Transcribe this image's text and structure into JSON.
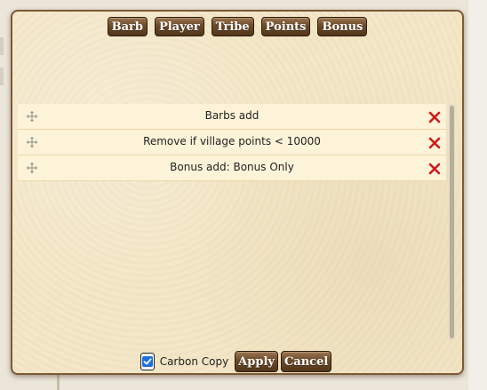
{
  "toolbar": {
    "buttons": [
      {
        "label": "Barb"
      },
      {
        "label": "Player"
      },
      {
        "label": "Tribe"
      },
      {
        "label": "Points"
      },
      {
        "label": "Bonus"
      }
    ]
  },
  "filters": {
    "items": [
      {
        "label": "Barbs add",
        "handle_icon": "drag-handle-icon",
        "remove_icon": "remove-x-icon"
      },
      {
        "label": "Remove if village points < 10000",
        "handle_icon": "drag-handle-icon",
        "remove_icon": "remove-x-icon"
      },
      {
        "label": "Bonus add: Bonus Only",
        "handle_icon": "drag-handle-icon",
        "remove_icon": "remove-x-icon"
      }
    ]
  },
  "footer": {
    "carbon_copy_label": "Carbon Copy",
    "carbon_copy_checked": true,
    "apply_label": "Apply",
    "cancel_label": "Cancel"
  },
  "colors": {
    "button_brown": "#6b4a2a",
    "dialog_border": "#7d5a36",
    "parchment": "#f3e6c6",
    "row_bg": "#fdf3d8",
    "remove_red": "#d11a1a",
    "checkbox_blue": "#1f6fe0"
  }
}
